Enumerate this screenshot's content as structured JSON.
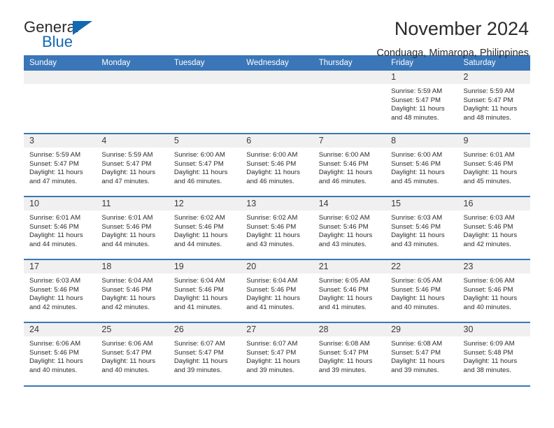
{
  "brand": {
    "name_dark": "General",
    "name_blue": "Blue",
    "accent_color": "#1268b3",
    "triangle_icon": "logo-triangle-icon"
  },
  "header": {
    "title": "November 2024",
    "subtitle": "Conduaga, Mimaropa, Philippines"
  },
  "theme": {
    "header_blue": "#3a76b8",
    "daynum_gray": "#f0f0f0"
  },
  "calendar": {
    "weekday_headers": [
      "Sunday",
      "Monday",
      "Tuesday",
      "Wednesday",
      "Thursday",
      "Friday",
      "Saturday"
    ],
    "weeks": [
      [
        {
          "day": "",
          "empty": true
        },
        {
          "day": "",
          "empty": true
        },
        {
          "day": "",
          "empty": true
        },
        {
          "day": "",
          "empty": true
        },
        {
          "day": "",
          "empty": true
        },
        {
          "day": "1",
          "sunrise": "Sunrise: 5:59 AM",
          "sunset": "Sunset: 5:47 PM",
          "daylight1": "Daylight: 11 hours",
          "daylight2": "and 48 minutes."
        },
        {
          "day": "2",
          "sunrise": "Sunrise: 5:59 AM",
          "sunset": "Sunset: 5:47 PM",
          "daylight1": "Daylight: 11 hours",
          "daylight2": "and 48 minutes."
        }
      ],
      [
        {
          "day": "3",
          "sunrise": "Sunrise: 5:59 AM",
          "sunset": "Sunset: 5:47 PM",
          "daylight1": "Daylight: 11 hours",
          "daylight2": "and 47 minutes."
        },
        {
          "day": "4",
          "sunrise": "Sunrise: 5:59 AM",
          "sunset": "Sunset: 5:47 PM",
          "daylight1": "Daylight: 11 hours",
          "daylight2": "and 47 minutes."
        },
        {
          "day": "5",
          "sunrise": "Sunrise: 6:00 AM",
          "sunset": "Sunset: 5:47 PM",
          "daylight1": "Daylight: 11 hours",
          "daylight2": "and 46 minutes."
        },
        {
          "day": "6",
          "sunrise": "Sunrise: 6:00 AM",
          "sunset": "Sunset: 5:46 PM",
          "daylight1": "Daylight: 11 hours",
          "daylight2": "and 46 minutes."
        },
        {
          "day": "7",
          "sunrise": "Sunrise: 6:00 AM",
          "sunset": "Sunset: 5:46 PM",
          "daylight1": "Daylight: 11 hours",
          "daylight2": "and 46 minutes."
        },
        {
          "day": "8",
          "sunrise": "Sunrise: 6:00 AM",
          "sunset": "Sunset: 5:46 PM",
          "daylight1": "Daylight: 11 hours",
          "daylight2": "and 45 minutes."
        },
        {
          "day": "9",
          "sunrise": "Sunrise: 6:01 AM",
          "sunset": "Sunset: 5:46 PM",
          "daylight1": "Daylight: 11 hours",
          "daylight2": "and 45 minutes."
        }
      ],
      [
        {
          "day": "10",
          "sunrise": "Sunrise: 6:01 AM",
          "sunset": "Sunset: 5:46 PM",
          "daylight1": "Daylight: 11 hours",
          "daylight2": "and 44 minutes."
        },
        {
          "day": "11",
          "sunrise": "Sunrise: 6:01 AM",
          "sunset": "Sunset: 5:46 PM",
          "daylight1": "Daylight: 11 hours",
          "daylight2": "and 44 minutes."
        },
        {
          "day": "12",
          "sunrise": "Sunrise: 6:02 AM",
          "sunset": "Sunset: 5:46 PM",
          "daylight1": "Daylight: 11 hours",
          "daylight2": "and 44 minutes."
        },
        {
          "day": "13",
          "sunrise": "Sunrise: 6:02 AM",
          "sunset": "Sunset: 5:46 PM",
          "daylight1": "Daylight: 11 hours",
          "daylight2": "and 43 minutes."
        },
        {
          "day": "14",
          "sunrise": "Sunrise: 6:02 AM",
          "sunset": "Sunset: 5:46 PM",
          "daylight1": "Daylight: 11 hours",
          "daylight2": "and 43 minutes."
        },
        {
          "day": "15",
          "sunrise": "Sunrise: 6:03 AM",
          "sunset": "Sunset: 5:46 PM",
          "daylight1": "Daylight: 11 hours",
          "daylight2": "and 43 minutes."
        },
        {
          "day": "16",
          "sunrise": "Sunrise: 6:03 AM",
          "sunset": "Sunset: 5:46 PM",
          "daylight1": "Daylight: 11 hours",
          "daylight2": "and 42 minutes."
        }
      ],
      [
        {
          "day": "17",
          "sunrise": "Sunrise: 6:03 AM",
          "sunset": "Sunset: 5:46 PM",
          "daylight1": "Daylight: 11 hours",
          "daylight2": "and 42 minutes."
        },
        {
          "day": "18",
          "sunrise": "Sunrise: 6:04 AM",
          "sunset": "Sunset: 5:46 PM",
          "daylight1": "Daylight: 11 hours",
          "daylight2": "and 42 minutes."
        },
        {
          "day": "19",
          "sunrise": "Sunrise: 6:04 AM",
          "sunset": "Sunset: 5:46 PM",
          "daylight1": "Daylight: 11 hours",
          "daylight2": "and 41 minutes."
        },
        {
          "day": "20",
          "sunrise": "Sunrise: 6:04 AM",
          "sunset": "Sunset: 5:46 PM",
          "daylight1": "Daylight: 11 hours",
          "daylight2": "and 41 minutes."
        },
        {
          "day": "21",
          "sunrise": "Sunrise: 6:05 AM",
          "sunset": "Sunset: 5:46 PM",
          "daylight1": "Daylight: 11 hours",
          "daylight2": "and 41 minutes."
        },
        {
          "day": "22",
          "sunrise": "Sunrise: 6:05 AM",
          "sunset": "Sunset: 5:46 PM",
          "daylight1": "Daylight: 11 hours",
          "daylight2": "and 40 minutes."
        },
        {
          "day": "23",
          "sunrise": "Sunrise: 6:06 AM",
          "sunset": "Sunset: 5:46 PM",
          "daylight1": "Daylight: 11 hours",
          "daylight2": "and 40 minutes."
        }
      ],
      [
        {
          "day": "24",
          "sunrise": "Sunrise: 6:06 AM",
          "sunset": "Sunset: 5:46 PM",
          "daylight1": "Daylight: 11 hours",
          "daylight2": "and 40 minutes."
        },
        {
          "day": "25",
          "sunrise": "Sunrise: 6:06 AM",
          "sunset": "Sunset: 5:47 PM",
          "daylight1": "Daylight: 11 hours",
          "daylight2": "and 40 minutes."
        },
        {
          "day": "26",
          "sunrise": "Sunrise: 6:07 AM",
          "sunset": "Sunset: 5:47 PM",
          "daylight1": "Daylight: 11 hours",
          "daylight2": "and 39 minutes."
        },
        {
          "day": "27",
          "sunrise": "Sunrise: 6:07 AM",
          "sunset": "Sunset: 5:47 PM",
          "daylight1": "Daylight: 11 hours",
          "daylight2": "and 39 minutes."
        },
        {
          "day": "28",
          "sunrise": "Sunrise: 6:08 AM",
          "sunset": "Sunset: 5:47 PM",
          "daylight1": "Daylight: 11 hours",
          "daylight2": "and 39 minutes."
        },
        {
          "day": "29",
          "sunrise": "Sunrise: 6:08 AM",
          "sunset": "Sunset: 5:47 PM",
          "daylight1": "Daylight: 11 hours",
          "daylight2": "and 39 minutes."
        },
        {
          "day": "30",
          "sunrise": "Sunrise: 6:09 AM",
          "sunset": "Sunset: 5:48 PM",
          "daylight1": "Daylight: 11 hours",
          "daylight2": "and 38 minutes."
        }
      ]
    ]
  }
}
